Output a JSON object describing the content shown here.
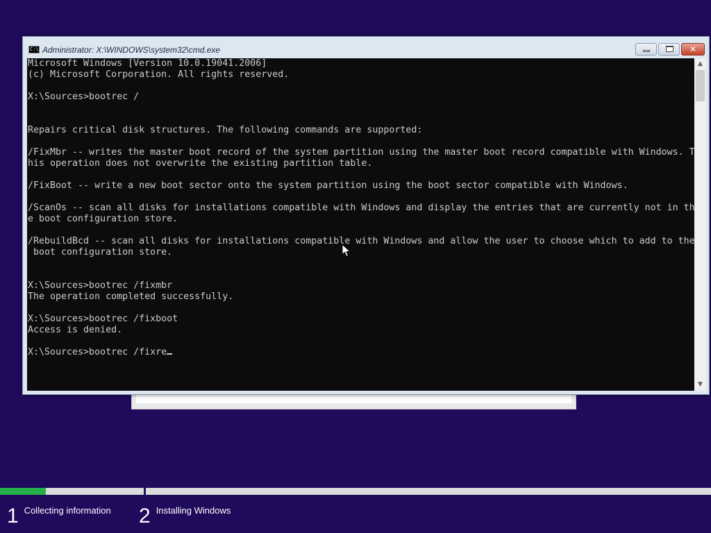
{
  "window": {
    "title": "Administrator: X:\\WINDOWS\\system32\\cmd.exe",
    "icon_label": "C:\\",
    "minimize_icon": "minimize-icon",
    "maximize_icon": "maximize-icon",
    "close_icon": "close-icon",
    "close_glyph": "✕"
  },
  "console": {
    "lines": [
      "Microsoft Windows [Version 10.0.19041.2006]",
      "(c) Microsoft Corporation. All rights reserved.",
      "",
      "X:\\Sources>bootrec /",
      "",
      "",
      "Repairs critical disk structures. The following commands are supported:",
      "",
      "/FixMbr -- writes the master boot record of the system partition using the master boot record compatible with Windows. T",
      "his operation does not overwrite the existing partition table.",
      "",
      "/FixBoot -- write a new boot sector onto the system partition using the boot sector compatible with Windows.",
      "",
      "/ScanOs -- scan all disks for installations compatible with Windows and display the entries that are currently not in th",
      "e boot configuration store.",
      "",
      "/RebuildBcd -- scan all disks for installations compatible with Windows and allow the user to choose which to add to the",
      " boot configuration store.",
      "",
      "",
      "X:\\Sources>bootrec /fixmbr",
      "The operation completed successfully.",
      "",
      "X:\\Sources>bootrec /fixboot",
      "Access is denied.",
      ""
    ],
    "current_input": "X:\\Sources>bootrec /fixre",
    "scroll_up_glyph": "▲",
    "scroll_down_glyph": "▼"
  },
  "setup": {
    "progress_step1_fraction": 0.32,
    "steps": [
      {
        "number": "1",
        "label": "Collecting information"
      },
      {
        "number": "2",
        "label": "Installing Windows"
      }
    ],
    "progress_color": "#25b04a",
    "background_color": "#1f0a5c"
  }
}
